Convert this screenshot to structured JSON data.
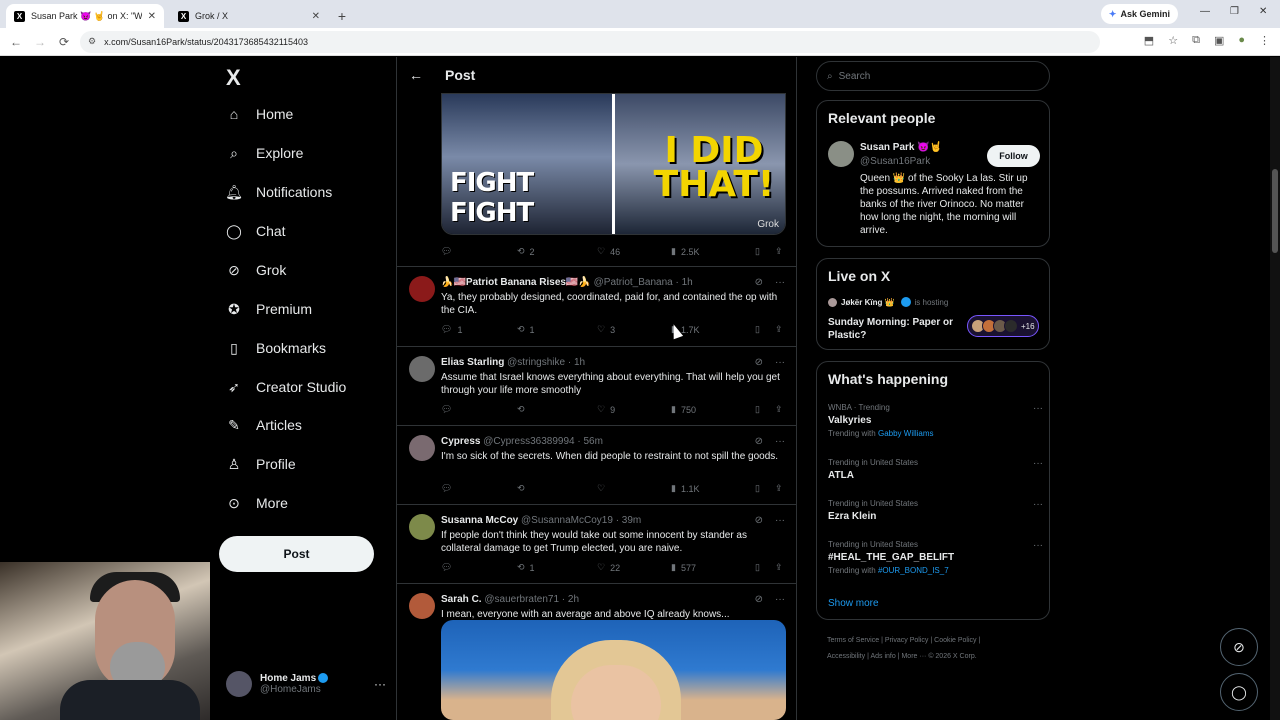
{
  "browser": {
    "tabs": [
      {
        "title": "Susan Park 😈 🤘 on X: \"Wow...",
        "favicon": "X"
      },
      {
        "title": "Grok / X",
        "favicon": "X"
      }
    ],
    "gemini_label": "Ask Gemini",
    "url": "x.com/Susan16Park/status/2043173685432115403"
  },
  "nav": {
    "logo": "X",
    "items": [
      {
        "label": "Home",
        "icon": "home-icon"
      },
      {
        "label": "Explore",
        "icon": "search-icon"
      },
      {
        "label": "Notifications",
        "icon": "bell-icon"
      },
      {
        "label": "Chat",
        "icon": "chat-icon"
      },
      {
        "label": "Grok",
        "icon": "grok-icon"
      },
      {
        "label": "Premium",
        "icon": "premium-icon"
      },
      {
        "label": "Bookmarks",
        "icon": "bookmark-icon"
      },
      {
        "label": "Creator Studio",
        "icon": "rocket-icon"
      },
      {
        "label": "Articles",
        "icon": "articles-icon"
      },
      {
        "label": "Profile",
        "icon": "profile-icon"
      },
      {
        "label": "More",
        "icon": "more-icon"
      }
    ],
    "post_button": "Post",
    "account": {
      "name": "Home Jams",
      "handle": "@HomeJams"
    }
  },
  "main": {
    "header_title": "Post",
    "media": {
      "left_caption": "FIGHT FIGHT",
      "right_caption": "I DID THAT!",
      "watermark": "Grok"
    },
    "main_post_stats": {
      "replies": "",
      "reposts": "2",
      "likes": "46",
      "views": "2.5K"
    },
    "replies": [
      {
        "name": "🍌🇺🇸Patriot Banana Rises🇺🇸🍌",
        "handle": "@Patriot_Banana",
        "time": "· 1h",
        "text": "Ya, they probably designed, coordinated, paid for, and contained the op with the CIA.",
        "stats": {
          "replies": "1",
          "reposts": "1",
          "likes": "3",
          "views": "1.7K"
        },
        "avatar_color": "#8b1a1a"
      },
      {
        "name": "Elias Starling",
        "handle": "@stringshike",
        "time": "· 1h",
        "text": "Assume that Israel knows everything about everything.  That will help you get through your life more smoothly",
        "stats": {
          "replies": "",
          "reposts": "",
          "likes": "9",
          "views": "750"
        },
        "avatar_color": "#6b6b6b"
      },
      {
        "name": "Cypress",
        "handle": "@Cypress36389994",
        "time": "· 56m",
        "text": "I'm so sick of the secrets.  When did people to restraint to not spill the goods.",
        "stats": {
          "replies": "",
          "reposts": "",
          "likes": "",
          "views": "1.1K"
        },
        "avatar_color": "#7a6a70"
      },
      {
        "name": "Susanna McCoy",
        "handle": "@SusannaMcCoy19",
        "time": "· 39m",
        "text": "If people don't think they would take out some innocent by stander as collateral damage to get Trump elected, you are naive.",
        "stats": {
          "replies": "",
          "reposts": "1",
          "likes": "22",
          "views": "577"
        },
        "avatar_color": "#7d8a4a"
      },
      {
        "name": "Sarah C.",
        "handle": "@sauerbraten71",
        "time": "· 2h",
        "text": "I mean, everyone with an average and above IQ already knows...",
        "stats": null,
        "avatar_color": "#b25a3a"
      }
    ]
  },
  "right": {
    "search_placeholder": "Search",
    "relevant": {
      "title": "Relevant people",
      "name": "Susan Park 😈🤘",
      "handle": "@Susan16Park",
      "follow_label": "Follow",
      "bio": "Queen 👑 of the Sooky La las. Stir up the possums. Arrived naked from the banks of the river Orinoco. No matter how long the night, the morning will arrive."
    },
    "live": {
      "title": "Live on X",
      "host_name": "Jøkër Kïng 👑",
      "host_status": "is hosting",
      "space_title": "Sunday Morning: Paper or Plastic?",
      "extra_count": "+16"
    },
    "happening": {
      "title": "What's happening",
      "trends": [
        {
          "meta": "WNBA · Trending",
          "topic": "Valkyries",
          "with_label": "Trending with",
          "with_link": "Gabby Williams"
        },
        {
          "meta": "Trending in United States",
          "topic": "ATLA",
          "with_label": "",
          "with_link": ""
        },
        {
          "meta": "Trending in United States",
          "topic": "Ezra Klein",
          "with_label": "",
          "with_link": ""
        },
        {
          "meta": "Trending in United States",
          "topic": "#HEAL_THE_GAP_BELIFT",
          "with_label": "Trending with",
          "with_link": "#OUR_BOND_IS_7"
        }
      ],
      "show_more": "Show more"
    },
    "footer": {
      "links": [
        "Terms of Service",
        "Privacy Policy",
        "Cookie Policy",
        "Accessibility",
        "Ads info",
        "More ···",
        "© 2026 X Corp."
      ]
    }
  },
  "colors": {
    "accent": "#1d9bf0",
    "bg": "#000000",
    "border": "#2f3336",
    "muted": "#71767b",
    "live_purple": "#7856ff"
  }
}
